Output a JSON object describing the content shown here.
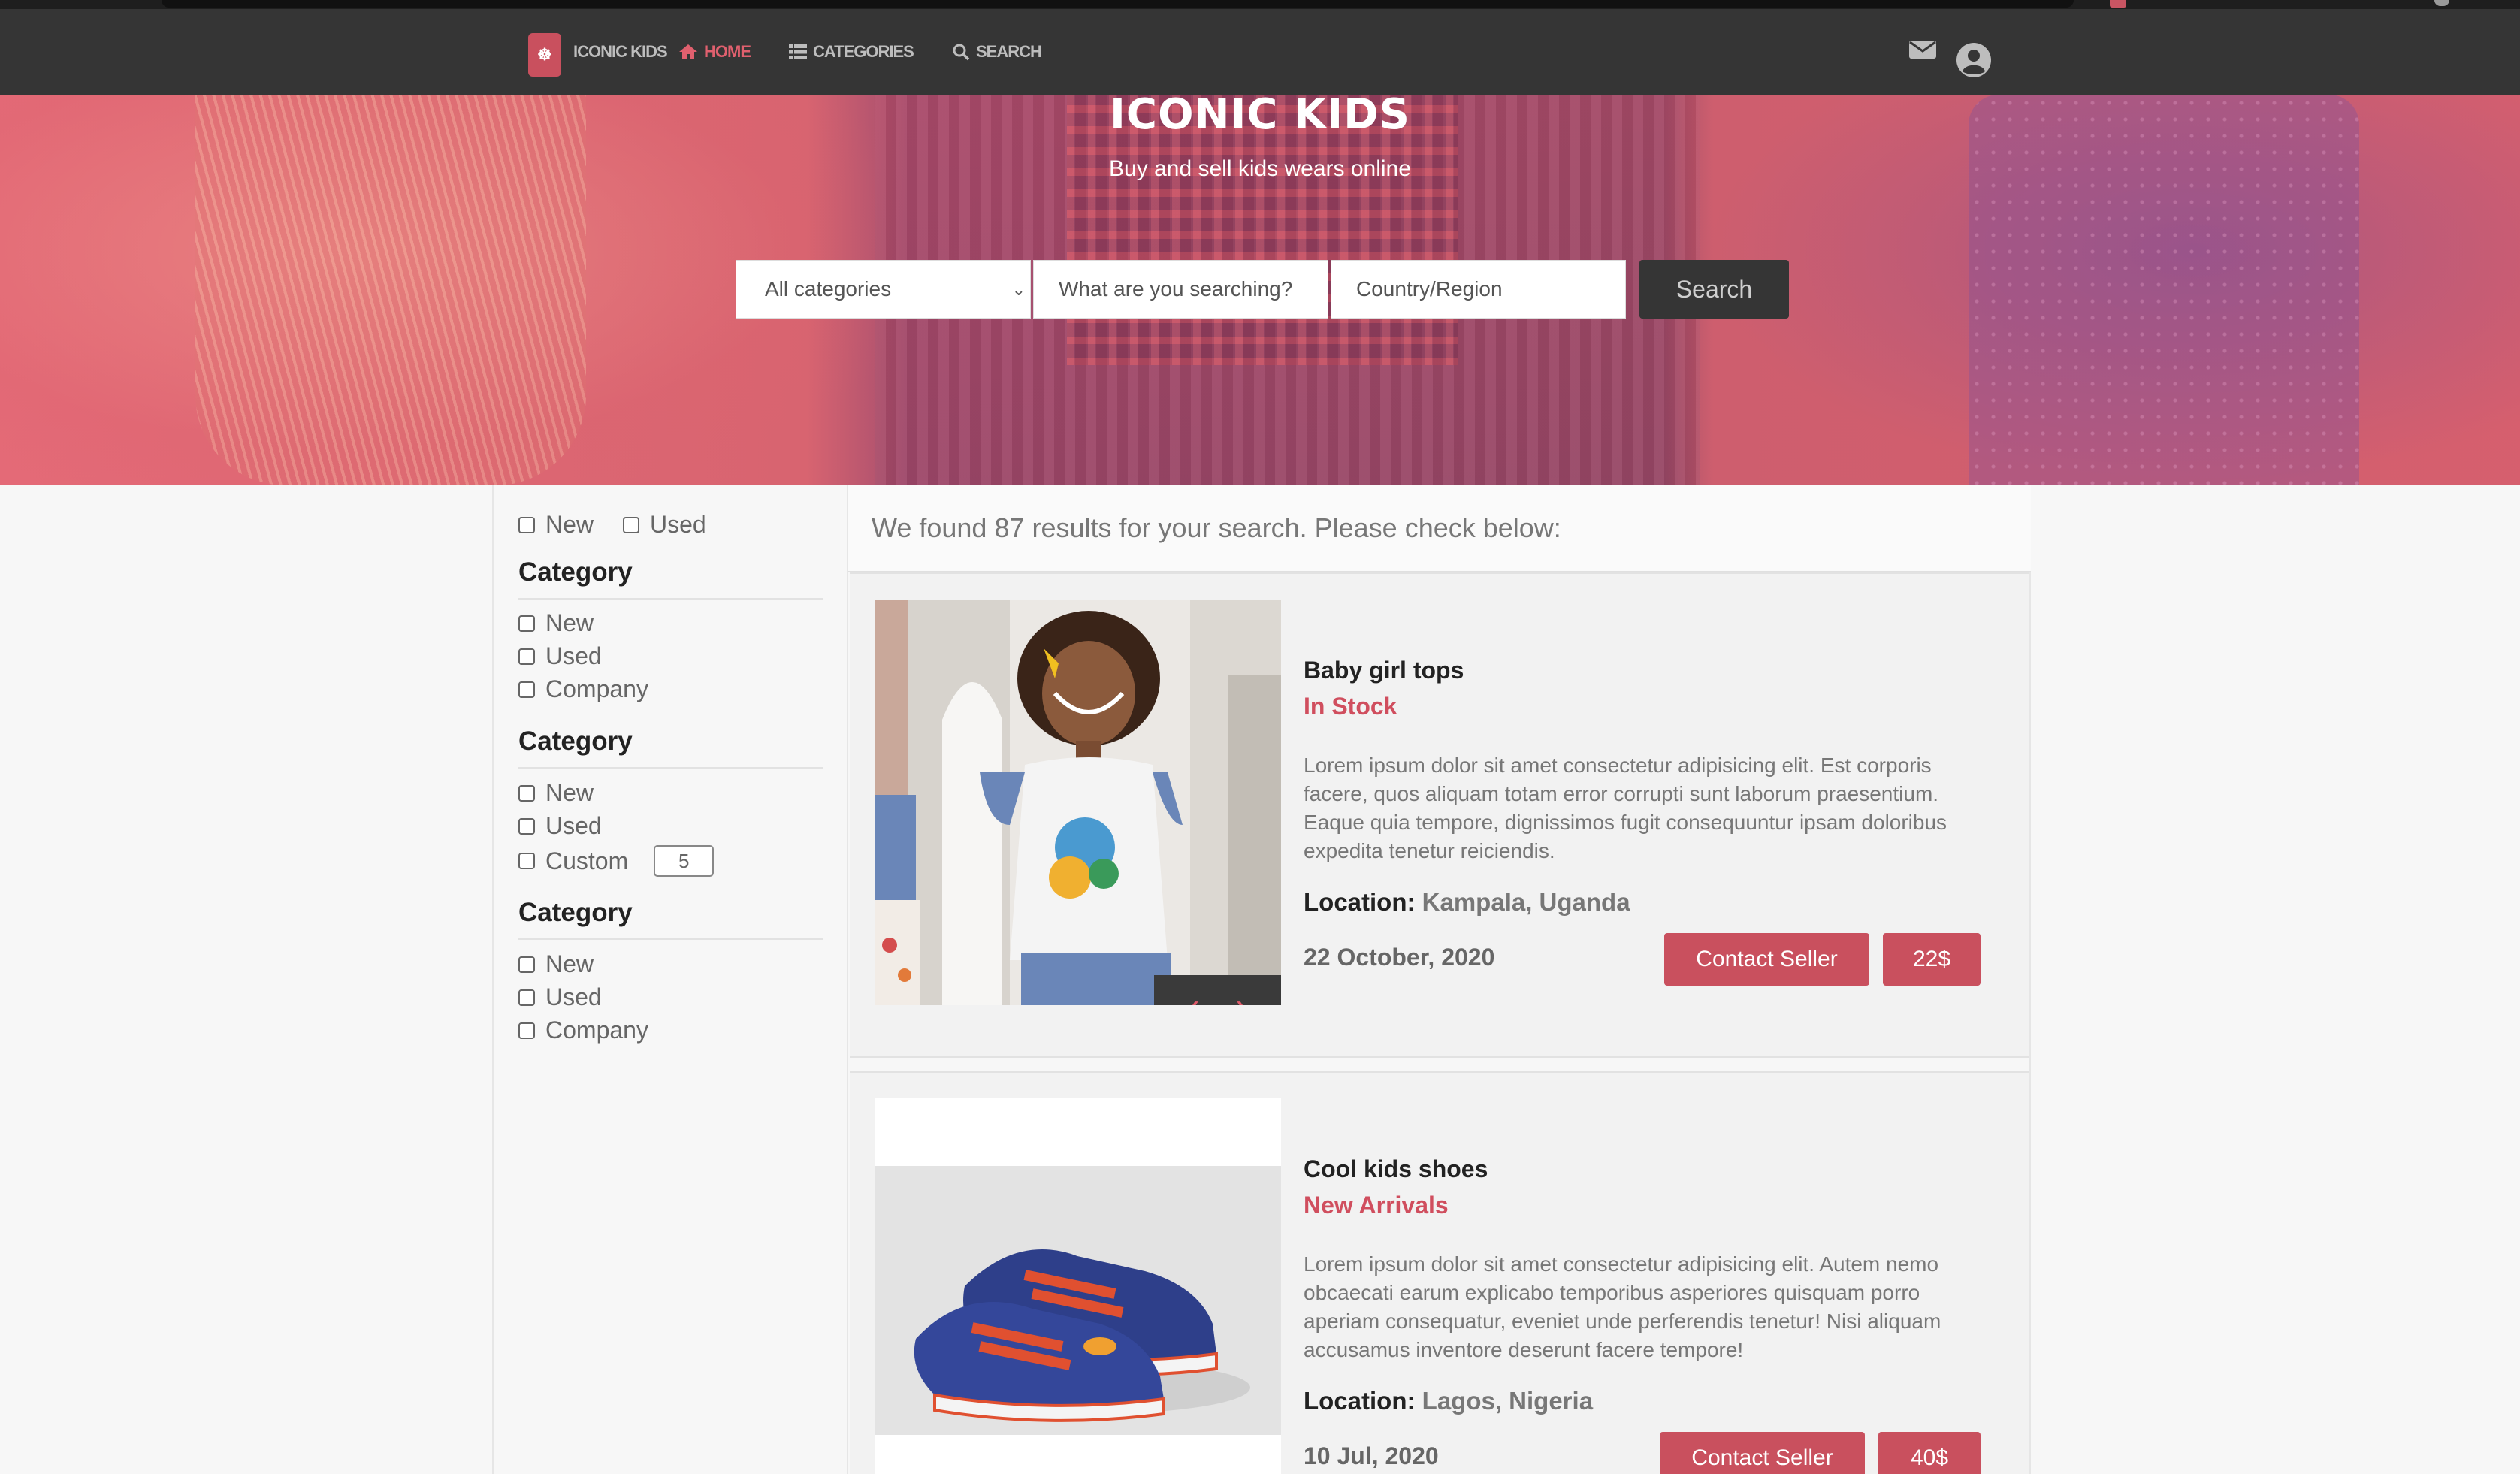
{
  "nav": {
    "logo_glyph": "☸",
    "brand": "ICONIC KIDS",
    "home": "HOME",
    "categories": "CATEGORIES",
    "search": "SEARCH",
    "icons": [
      "home-icon",
      "list-icon",
      "search-icon",
      "mail-icon",
      "user-circle-icon"
    ]
  },
  "hero": {
    "title": "ICONIC KIDS",
    "subtitle": "Buy and sell kids wears online",
    "category_select": "All categories",
    "query_placeholder": "What are you searching?",
    "region_placeholder": "Country/Region",
    "search_button": "Search"
  },
  "filters": {
    "condition": [
      {
        "label": "New",
        "checked": false
      },
      {
        "label": "Used",
        "checked": false
      }
    ],
    "groups": [
      {
        "title": "Category",
        "options": [
          "New",
          "Used",
          "Company"
        ]
      },
      {
        "title": "Category",
        "options": [
          "New",
          "Used",
          "Custom"
        ],
        "custom_value": "5"
      },
      {
        "title": "Category",
        "options": [
          "New",
          "Used",
          "Company"
        ]
      }
    ]
  },
  "results": {
    "summary": "We found 87 results for your search. Please check below:",
    "items": [
      {
        "title": "Baby girl tops",
        "status": "In Stock",
        "description": "Lorem ipsum dolor sit amet consectetur adipisicing elit. Est corporis facere, quos aliquam totam error corrupti sunt laborum praesentium. Eaque quia tempore, dignissimos fugit consequuntur ipsam doloribus expedita tenetur reiciendis.",
        "location_label": "Location:",
        "location": "Kampala, Uganda",
        "date": "22 October, 2020",
        "contact": "Contact Seller",
        "price": "22$"
      },
      {
        "title": "Cool kids shoes",
        "status": "New Arrivals",
        "description": "Lorem ipsum dolor sit amet consectetur adipisicing elit. Autem nemo obcaecati earum explicabo temporibus asperiores quisquam porro aperiam consequatur, eveniet unde perferendis tenetur! Nisi aliquam accusamus inventore deserunt facere tempore!",
        "location_label": "Location:",
        "location": "Lagos, Nigeria",
        "date": "10 Jul, 2020",
        "contact": "Contact Seller",
        "price": "40$"
      }
    ],
    "pager": {
      "prev": "‹",
      "next": "›"
    }
  },
  "colors": {
    "accent": "#c9505e",
    "navbar": "#353535",
    "status_text": "#d04e5e"
  }
}
